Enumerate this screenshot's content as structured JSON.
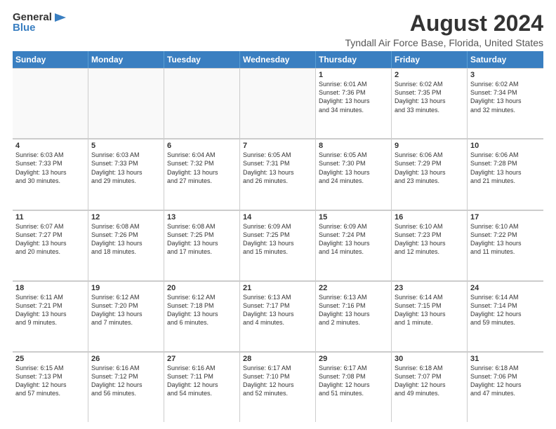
{
  "logo": {
    "line1": "General",
    "line2": "Blue"
  },
  "title": "August 2024",
  "subtitle": "Tyndall Air Force Base, Florida, United States",
  "days": [
    "Sunday",
    "Monday",
    "Tuesday",
    "Wednesday",
    "Thursday",
    "Friday",
    "Saturday"
  ],
  "weeks": [
    [
      {
        "day": "",
        "empty": true,
        "text": ""
      },
      {
        "day": "",
        "empty": true,
        "text": ""
      },
      {
        "day": "",
        "empty": true,
        "text": ""
      },
      {
        "day": "",
        "empty": true,
        "text": ""
      },
      {
        "day": "1",
        "text": "Sunrise: 6:01 AM\nSunset: 7:36 PM\nDaylight: 13 hours\nand 34 minutes."
      },
      {
        "day": "2",
        "text": "Sunrise: 6:02 AM\nSunset: 7:35 PM\nDaylight: 13 hours\nand 33 minutes."
      },
      {
        "day": "3",
        "text": "Sunrise: 6:02 AM\nSunset: 7:34 PM\nDaylight: 13 hours\nand 32 minutes."
      }
    ],
    [
      {
        "day": "4",
        "text": "Sunrise: 6:03 AM\nSunset: 7:33 PM\nDaylight: 13 hours\nand 30 minutes."
      },
      {
        "day": "5",
        "text": "Sunrise: 6:03 AM\nSunset: 7:33 PM\nDaylight: 13 hours\nand 29 minutes."
      },
      {
        "day": "6",
        "text": "Sunrise: 6:04 AM\nSunset: 7:32 PM\nDaylight: 13 hours\nand 27 minutes."
      },
      {
        "day": "7",
        "text": "Sunrise: 6:05 AM\nSunset: 7:31 PM\nDaylight: 13 hours\nand 26 minutes."
      },
      {
        "day": "8",
        "text": "Sunrise: 6:05 AM\nSunset: 7:30 PM\nDaylight: 13 hours\nand 24 minutes."
      },
      {
        "day": "9",
        "text": "Sunrise: 6:06 AM\nSunset: 7:29 PM\nDaylight: 13 hours\nand 23 minutes."
      },
      {
        "day": "10",
        "text": "Sunrise: 6:06 AM\nSunset: 7:28 PM\nDaylight: 13 hours\nand 21 minutes."
      }
    ],
    [
      {
        "day": "11",
        "text": "Sunrise: 6:07 AM\nSunset: 7:27 PM\nDaylight: 13 hours\nand 20 minutes."
      },
      {
        "day": "12",
        "text": "Sunrise: 6:08 AM\nSunset: 7:26 PM\nDaylight: 13 hours\nand 18 minutes."
      },
      {
        "day": "13",
        "text": "Sunrise: 6:08 AM\nSunset: 7:25 PM\nDaylight: 13 hours\nand 17 minutes."
      },
      {
        "day": "14",
        "text": "Sunrise: 6:09 AM\nSunset: 7:25 PM\nDaylight: 13 hours\nand 15 minutes."
      },
      {
        "day": "15",
        "text": "Sunrise: 6:09 AM\nSunset: 7:24 PM\nDaylight: 13 hours\nand 14 minutes."
      },
      {
        "day": "16",
        "text": "Sunrise: 6:10 AM\nSunset: 7:23 PM\nDaylight: 13 hours\nand 12 minutes."
      },
      {
        "day": "17",
        "text": "Sunrise: 6:10 AM\nSunset: 7:22 PM\nDaylight: 13 hours\nand 11 minutes."
      }
    ],
    [
      {
        "day": "18",
        "text": "Sunrise: 6:11 AM\nSunset: 7:21 PM\nDaylight: 13 hours\nand 9 minutes."
      },
      {
        "day": "19",
        "text": "Sunrise: 6:12 AM\nSunset: 7:20 PM\nDaylight: 13 hours\nand 7 minutes."
      },
      {
        "day": "20",
        "text": "Sunrise: 6:12 AM\nSunset: 7:18 PM\nDaylight: 13 hours\nand 6 minutes."
      },
      {
        "day": "21",
        "text": "Sunrise: 6:13 AM\nSunset: 7:17 PM\nDaylight: 13 hours\nand 4 minutes."
      },
      {
        "day": "22",
        "text": "Sunrise: 6:13 AM\nSunset: 7:16 PM\nDaylight: 13 hours\nand 2 minutes."
      },
      {
        "day": "23",
        "text": "Sunrise: 6:14 AM\nSunset: 7:15 PM\nDaylight: 13 hours\nand 1 minute."
      },
      {
        "day": "24",
        "text": "Sunrise: 6:14 AM\nSunset: 7:14 PM\nDaylight: 12 hours\nand 59 minutes."
      }
    ],
    [
      {
        "day": "25",
        "text": "Sunrise: 6:15 AM\nSunset: 7:13 PM\nDaylight: 12 hours\nand 57 minutes."
      },
      {
        "day": "26",
        "text": "Sunrise: 6:16 AM\nSunset: 7:12 PM\nDaylight: 12 hours\nand 56 minutes."
      },
      {
        "day": "27",
        "text": "Sunrise: 6:16 AM\nSunset: 7:11 PM\nDaylight: 12 hours\nand 54 minutes."
      },
      {
        "day": "28",
        "text": "Sunrise: 6:17 AM\nSunset: 7:10 PM\nDaylight: 12 hours\nand 52 minutes."
      },
      {
        "day": "29",
        "text": "Sunrise: 6:17 AM\nSunset: 7:08 PM\nDaylight: 12 hours\nand 51 minutes."
      },
      {
        "day": "30",
        "text": "Sunrise: 6:18 AM\nSunset: 7:07 PM\nDaylight: 12 hours\nand 49 minutes."
      },
      {
        "day": "31",
        "text": "Sunrise: 6:18 AM\nSunset: 7:06 PM\nDaylight: 12 hours\nand 47 minutes."
      }
    ]
  ]
}
